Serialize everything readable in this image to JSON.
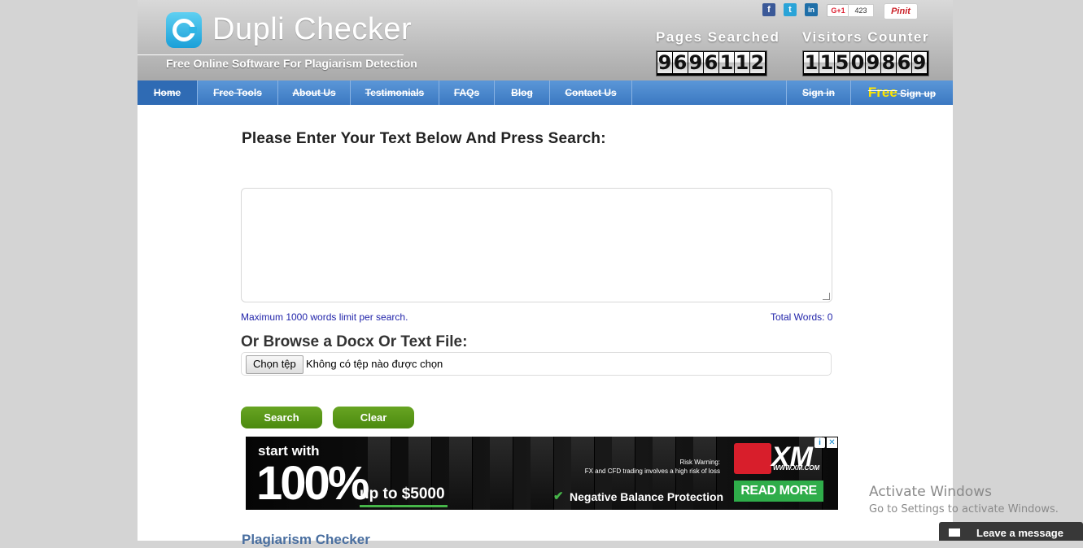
{
  "brand": {
    "logo_letter": "C",
    "name": "Dupli Checker",
    "tagline": "Free Online Software For Plagiarism Detection"
  },
  "social": {
    "facebook": "f",
    "twitter": "t",
    "linkedin": "in",
    "gplus_label": "G+1",
    "gplus_count": "423",
    "pinterest": "Pinit"
  },
  "counters": {
    "pages_label": "Pages Searched",
    "pages_digits": [
      "9",
      "6",
      "9",
      "6",
      "1",
      "1",
      "2"
    ],
    "visitors_label": "Visitors Counter",
    "visitors_digits": [
      "1",
      "1",
      "5",
      "0",
      "9",
      "8",
      "6",
      "9"
    ]
  },
  "nav": {
    "items": [
      "Home",
      "Free Tools",
      "About Us",
      "Testimonials",
      "FAQs",
      "Blog",
      "Contact Us"
    ],
    "sign_in": "Sign in",
    "free": "Free",
    "sign_up": "Sign up"
  },
  "form": {
    "heading": "Please Enter Your Text Below And Press Search:",
    "limit_note": "Maximum 1000 words limit per search.",
    "total_words": "Total Words: 0",
    "browse_label": "Or Browse a Docx Or Text File:",
    "file_button": "Chọn tệp",
    "file_status": "Không có tệp nào được chọn",
    "search_button": "Search",
    "clear_button": "Clear"
  },
  "ad": {
    "start": "start with",
    "big": "100%",
    "upto": "up to $5000",
    "risk_title": "Risk Warning:",
    "risk_text": "FX and CFD trading involves a high risk of loss",
    "negative": "Negative Balance Protection",
    "brand": "XM",
    "url": "WWW.XM.COM",
    "cta": "READ MORE"
  },
  "section_title": "Plagiarism Checker",
  "overlay": {
    "activate_title": "Activate Windows",
    "activate_sub": "Go to Settings to activate Windows.",
    "leave_message": "Leave a message"
  },
  "colors": {
    "nav_blue": "#4a87cd",
    "button_green": "#5a9a17",
    "free_yellow": "#ffe600"
  }
}
